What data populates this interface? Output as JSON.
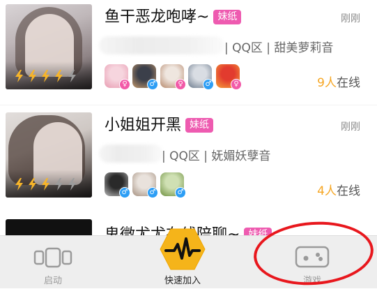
{
  "cards": [
    {
      "title": "鱼干恶龙咆哮~",
      "badge": "妹纸",
      "time": "刚刚",
      "meta": "| QQ区 | 甜美萝莉音",
      "rating": 4,
      "rating_max": 5,
      "online_count": "9人",
      "online_suffix": "在线",
      "members": [
        "female",
        "male",
        "female",
        "male",
        "female"
      ]
    },
    {
      "title": "小姐姐开黑",
      "badge": "妹纸",
      "time": "刚刚",
      "meta": "| QQ区 | 妩媚妖孽音",
      "rating": 3,
      "rating_max": 5,
      "online_count": "4人",
      "online_suffix": "在线",
      "members": [
        "male",
        "male",
        "male"
      ]
    }
  ],
  "partial_card": {
    "title": "鬼微尤尤在线陪聊~",
    "badge": "妹纸"
  },
  "tabbar": {
    "start_label": "启动",
    "quick_join_label": "快速加入",
    "games_label": "游戏"
  },
  "colors": {
    "badge": "#ee5bb0",
    "online_count": "#f6a623",
    "hex_button": "#f5b41a",
    "annotation": "#e8171d"
  },
  "icons": {
    "start": "layout-panels-icon",
    "quick_join": "pulse-wave-icon",
    "games": "gamepad-icon",
    "rating": "lightning-bolt-icon"
  }
}
